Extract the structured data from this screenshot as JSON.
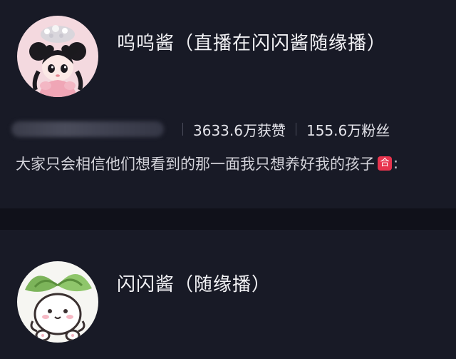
{
  "accounts": [
    {
      "name": "呜呜酱（直播在闪闪酱随缘播）",
      "avatar_icon": "girl-with-crown-avatar",
      "likes": "3633.6万获赞",
      "followers": "155.6万粉丝",
      "bio": "大家只会相信他们想看到的那一面我只想养好我的孩子",
      "bio_badge": "合",
      "bio_tail": ":"
    },
    {
      "name": "闪闪酱（随缘播）",
      "avatar_icon": "radish-bunny-avatar"
    }
  ],
  "colors": {
    "background": "#181a26",
    "divider": "#10111a",
    "badge": "#e8344e"
  }
}
